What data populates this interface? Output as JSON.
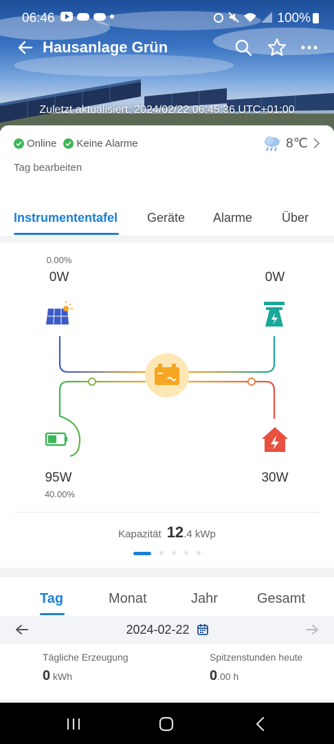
{
  "status_bar": {
    "time": "06:46",
    "battery": "100%"
  },
  "app_bar": {
    "title": "Hausanlage Grün",
    "icons": [
      "back-arrow-icon",
      "search-icon",
      "star-icon",
      "more-icon"
    ]
  },
  "hero": {
    "updated": "Zuletzt aktualisiert: 2024/02/22 06:45:36 UTC+01:00"
  },
  "info": {
    "online": "Online",
    "alarms": "Keine Alarme",
    "temperature": "8℃",
    "edit_tag": "Tag bearbeiten"
  },
  "tabs": [
    "Instrumententafel",
    "Geräte",
    "Alarme",
    "Über"
  ],
  "flow": {
    "pv_percent": "0.00%",
    "pv_power": "0W",
    "grid_power": "0W",
    "battery_power": "95W",
    "battery_soc": "40.00%",
    "load_power": "30W",
    "capacity_label": "Kapazität",
    "capacity_int": "12",
    "capacity_dec": ".4 kWp"
  },
  "period": {
    "tabs": [
      "Tag",
      "Monat",
      "Jahr",
      "Gesamt"
    ],
    "date": "2024-02-22",
    "daily_gen_label": "Tägliche Erzeugung",
    "daily_gen_value": "0",
    "daily_gen_unit": " kWh",
    "peak_label": "Spitzenstunden heute",
    "peak_value": "0",
    "peak_unit": ".00 h"
  },
  "colors": {
    "accent": "#1a7fd9",
    "pv": "#3b5bc6",
    "grid": "#18a99a",
    "battery": "#3cb657",
    "load": "#e8503f",
    "inverter": "#f5a623"
  }
}
